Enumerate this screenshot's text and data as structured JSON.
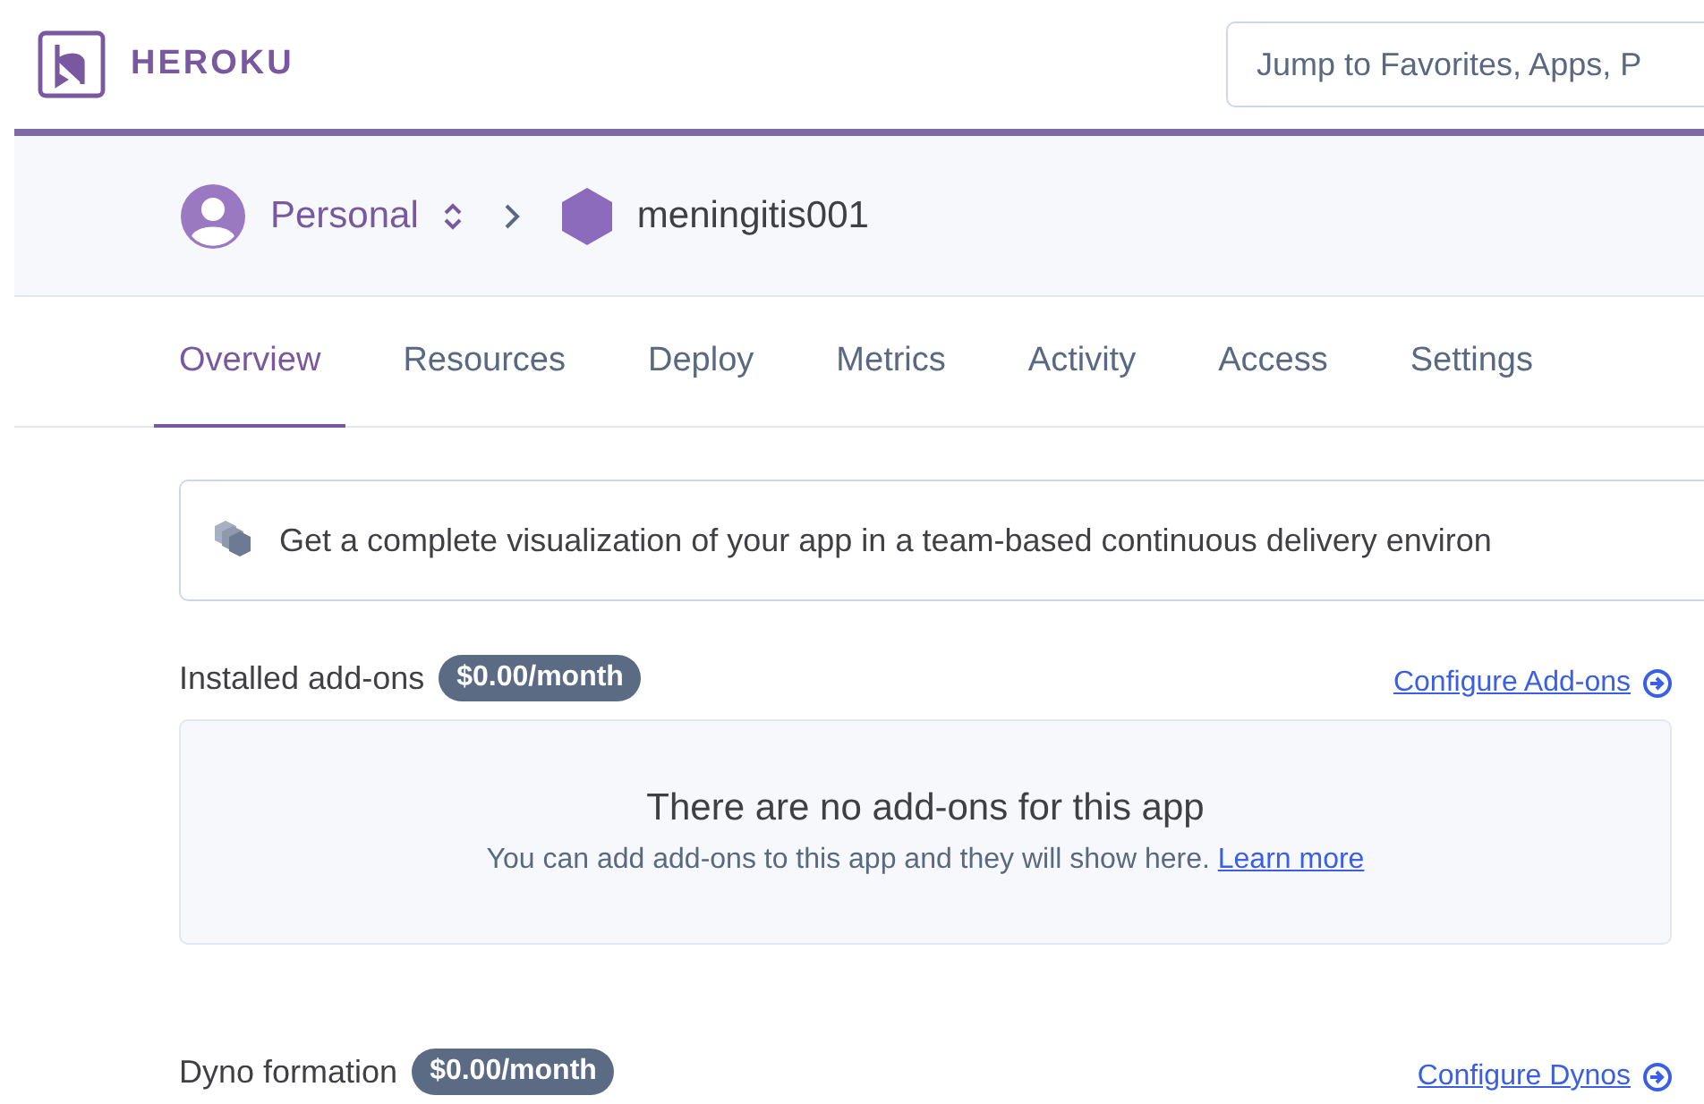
{
  "header": {
    "logo_text": "HEROKU",
    "search": {
      "placeholder": "Jump to Favorites, Apps, P"
    }
  },
  "breadcrumb": {
    "account": "Personal",
    "app": "meningitis001"
  },
  "tabs": [
    {
      "label": "Overview",
      "selected": true
    },
    {
      "label": "Resources",
      "selected": false
    },
    {
      "label": "Deploy",
      "selected": false
    },
    {
      "label": "Metrics",
      "selected": false
    },
    {
      "label": "Activity",
      "selected": false
    },
    {
      "label": "Access",
      "selected": false
    },
    {
      "label": "Settings",
      "selected": false
    }
  ],
  "banner": {
    "text": "Get a complete visualization of your app in a team-based continuous delivery environ"
  },
  "sections": [
    {
      "title": "Installed add-ons",
      "price": "$0.00/month",
      "link": "Configure Add-ons",
      "empty_state": {
        "title": "There are no add-ons for this app",
        "text": "You can add add-ons to this app and they will show here.",
        "link": "Learn more"
      }
    },
    {
      "title": "Dyno formation",
      "price": "$0.00/month",
      "link": "Configure Dynos"
    }
  ]
}
